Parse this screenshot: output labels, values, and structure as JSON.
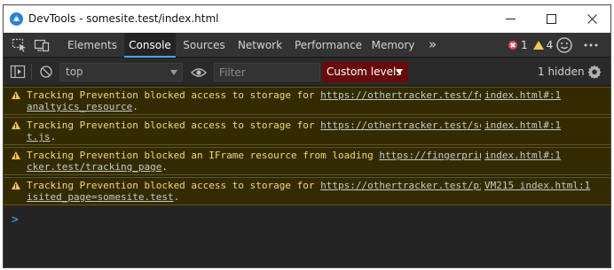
{
  "window": {
    "title": "DevTools - somesite.test/index.html"
  },
  "tabs": [
    {
      "label": "Elements"
    },
    {
      "label": "Console"
    },
    {
      "label": "Sources"
    },
    {
      "label": "Network"
    },
    {
      "label": "Performance"
    },
    {
      "label": "Memory"
    }
  ],
  "more_tabs_icon": "»",
  "issues": {
    "errors": "1",
    "warnings": "4"
  },
  "console_toolbar": {
    "context": "top",
    "filter_placeholder": "Filter",
    "levels_label": "Custom levels",
    "hidden_label": "1 hidden"
  },
  "messages": [
    {
      "prefix": "Tracking Prevention blocked access to storage for ",
      "url": "https://othertracker.test/fetch_analtyics_resource",
      "suffix": ".",
      "source": "index.html#:1"
    },
    {
      "prefix": "Tracking Prevention blocked access to storage for ",
      "url": "https://othertracker.test/script.js",
      "suffix": ".",
      "source": "index.html#:1"
    },
    {
      "prefix": "Tracking Prevention blocked an IFrame resource from loading ",
      "url": "https://fingerprinttracker.test/tracking_page",
      "suffix": ".",
      "source": "index.html#:1"
    },
    {
      "prefix": "Tracking Prevention blocked access to storage for ",
      "url": "https://othertracker.test/ping?visited_page=somesite.test",
      "suffix": ".",
      "source": "VM215 index.html:1"
    }
  ],
  "prompt_symbol": ">",
  "colors": {
    "accent": "#4da3ff",
    "error": "#e8464b",
    "warning": "#f2c94c",
    "warning_bg": "#332b00",
    "levels_bg": "#6a0a0a"
  }
}
